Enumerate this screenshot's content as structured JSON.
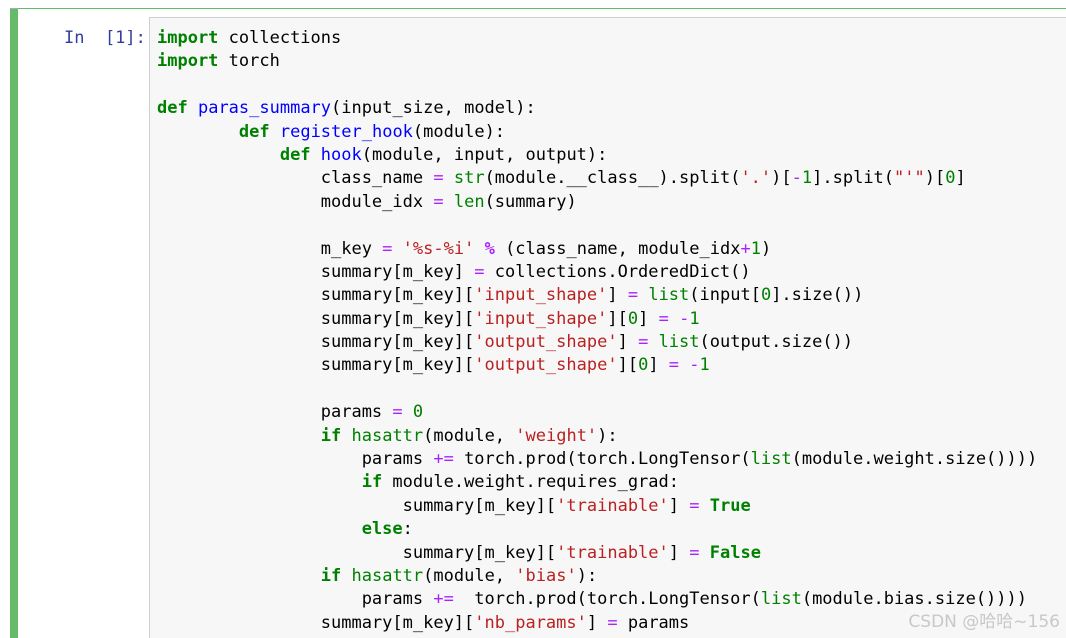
{
  "cell": {
    "prompt": "In  [1]:",
    "language": "python",
    "accent_color": "#66bb6a",
    "code_lines": [
      "import collections",
      "import torch",
      "",
      "def paras_summary(input_size, model):",
      "        def register_hook(module):",
      "            def hook(module, input, output):",
      "                class_name = str(module.__class__).split('.')[-1].split(\"'\")[0]",
      "                module_idx = len(summary)",
      "",
      "                m_key = '%s-%i' % (class_name, module_idx+1)",
      "                summary[m_key] = collections.OrderedDict()",
      "                summary[m_key]['input_shape'] = list(input[0].size())",
      "                summary[m_key]['input_shape'][0] = -1",
      "                summary[m_key]['output_shape'] = list(output.size())",
      "                summary[m_key]['output_shape'][0] = -1",
      "",
      "                params = 0",
      "                if hasattr(module, 'weight'):",
      "                    params += torch.prod(torch.LongTensor(list(module.weight.size())))",
      "                    if module.weight.requires_grad:",
      "                        summary[m_key]['trainable'] = True",
      "                    else:",
      "                        summary[m_key]['trainable'] = False",
      "                if hasattr(module, 'bias'):",
      "                    params +=  torch.prod(torch.LongTensor(list(module.bias.size())))",
      "                summary[m_key]['nb_params'] = params"
    ]
  },
  "watermark": "CSDN @哈哈~156"
}
